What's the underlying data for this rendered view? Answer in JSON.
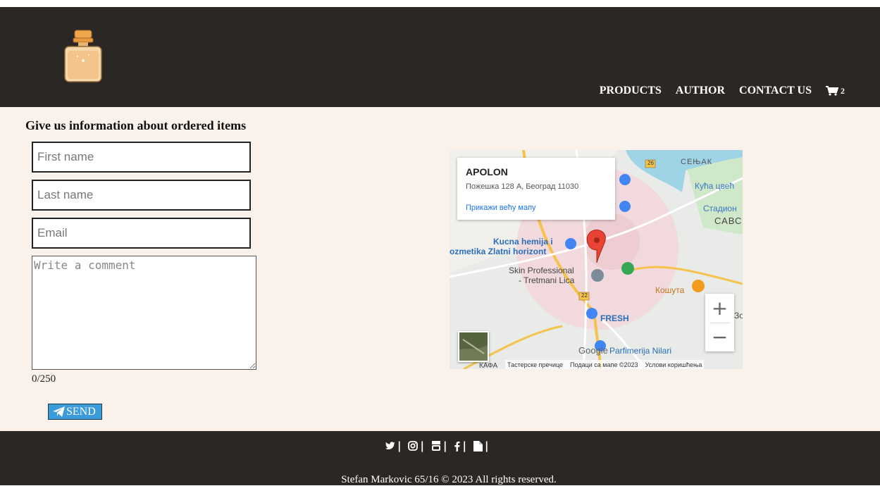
{
  "nav": {
    "items": [
      {
        "label": "PRODUCTS"
      },
      {
        "label": "AUTHOR"
      },
      {
        "label": "CONTACT US"
      }
    ],
    "cart_count": "2"
  },
  "form": {
    "title": "Give us information about ordered items",
    "first_name_placeholder": "First name",
    "last_name_placeholder": "Last name",
    "email_placeholder": "Email",
    "comment_placeholder": "Write a comment",
    "counter": "0/250",
    "send_label": "SEND"
  },
  "map": {
    "place_name": "APOLON",
    "place_address": "Пожешка 128 А, Београд 11030",
    "larger_map_link": "Прикажи већу мапу",
    "zoom_in": "+",
    "zoom_out": "−",
    "attribution": {
      "shortcuts": "Тастерске пречице",
      "data": "Подаци са мапе ©2023",
      "terms": "Услови коришћења"
    },
    "labels": {
      "senjak": "СЕЊАК",
      "kuca_cveca": "Кућа цвећ",
      "stadion": "Стадион",
      "savski": "САВС",
      "kucna_hemija_1": "Kucna hemija i",
      "kucna_hemija_2": "ozmetika Zlatni horizont",
      "skin_1": "Skin Professional",
      "skin_2": "- Tretmani Lica",
      "kosuta": "Кошута",
      "fresh": "FRESH",
      "google": "Google",
      "parfimerija": "Parfimerija Nilari",
      "kafana": "КАФА",
      "road_26": "26",
      "road_22": "22",
      "partial_right": "Зо"
    }
  },
  "footer": {
    "copyright": "Stefan Markovic 65/16 © 2023 All rights reserved."
  },
  "icons": {
    "social": [
      "twitter-icon",
      "instagram-icon",
      "youtube-icon",
      "facebook-icon",
      "document-icon"
    ]
  },
  "colors": {
    "header_bg": "#2b2724",
    "page_bg": "#faf1ea",
    "send_button": "#3a9bd9",
    "map_pin": "#ea4335",
    "map_link": "#1a73e8"
  }
}
